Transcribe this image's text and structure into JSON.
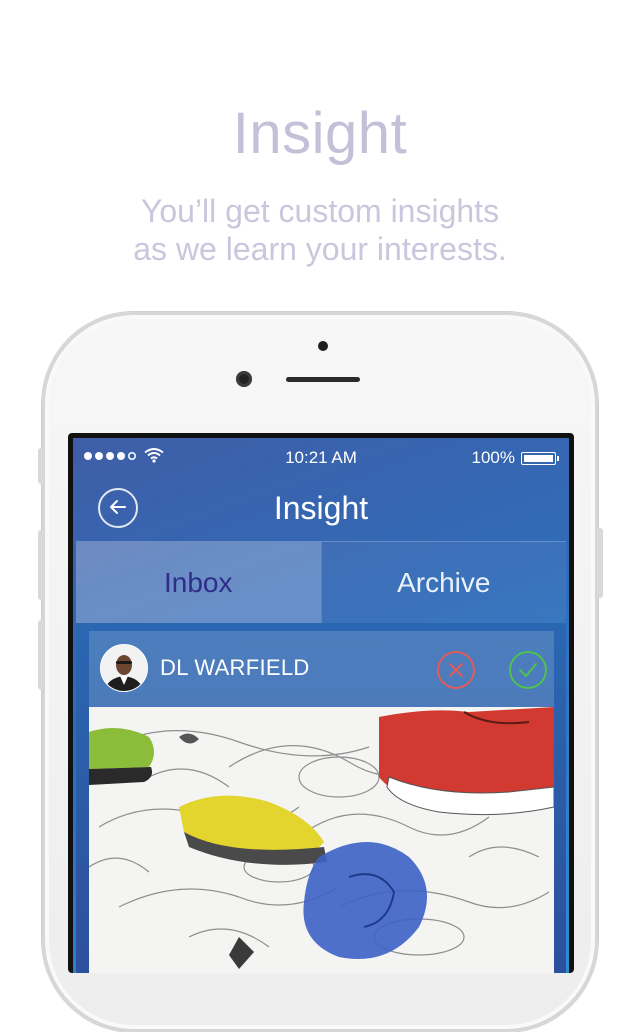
{
  "headline": "Insight",
  "subline": [
    "You’ll get custom insights",
    "as we learn your interests."
  ],
  "status_bar": {
    "time": "10:21 AM",
    "battery": "100%",
    "signal_dots": 4
  },
  "nav": {
    "title": "Insight",
    "back_icon": "back-arrow-icon"
  },
  "tabs": [
    {
      "label": "Inbox",
      "selected": true
    },
    {
      "label": "Archive",
      "selected": false
    }
  ],
  "card": {
    "author": "DL WARFIELD",
    "reject_icon": "close-circle-icon",
    "approve_icon": "check-circle-icon"
  },
  "colors": {
    "headline": "#c3c0d8",
    "accent_blue": "#2b8fd0",
    "reject_red": "#e25b5b",
    "approve_green": "#4ec24e"
  }
}
